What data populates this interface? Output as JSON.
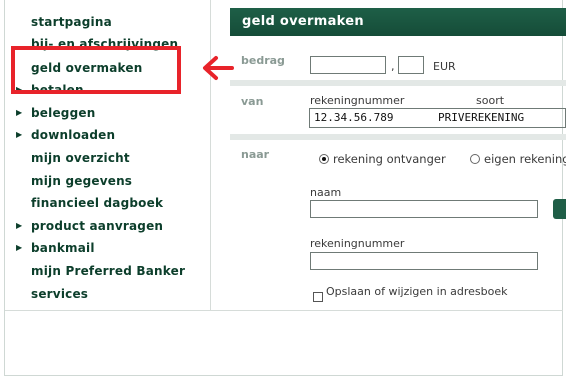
{
  "nav": {
    "items": [
      {
        "label": "startpagina",
        "arrow": false
      },
      {
        "label": "bij- en afschrijvingen",
        "arrow": false
      },
      {
        "label": "geld overmaken",
        "arrow": false
      },
      {
        "label": "betalen",
        "arrow": true
      },
      {
        "label": "beleggen",
        "arrow": true
      },
      {
        "label": "downloaden",
        "arrow": true
      },
      {
        "label": "mijn overzicht",
        "arrow": false
      },
      {
        "label": "mijn gegevens",
        "arrow": false
      },
      {
        "label": "financieel dagboek",
        "arrow": false
      },
      {
        "label": "product aanvragen",
        "arrow": true
      },
      {
        "label": "bankmail",
        "arrow": true
      },
      {
        "label": "mijn Preferred Banker",
        "arrow": false
      },
      {
        "label": "services",
        "arrow": false
      }
    ]
  },
  "form": {
    "title": "geld overmaken",
    "bedrag_label": "bedrag",
    "amount_separator": ",",
    "currency": "EUR",
    "van_label": "van",
    "col_rekeningnummer": "rekeningnummer",
    "col_soort": "soort",
    "account_number": "12.34.56.789",
    "account_type": "PRIVEREKENING",
    "naar_label": "naar",
    "radio_ontvanger": "rekening ontvanger",
    "radio_eigen": "eigen rekening",
    "naam_label": "naam",
    "rekeningnummer_label": "rekeningnummer",
    "checkbox_label": "Opslaan of wijzigen in adresboek"
  },
  "colors": {
    "brand_green": "#154c38",
    "nav_text": "#0c3e2b",
    "highlight_red": "#e8232a"
  }
}
